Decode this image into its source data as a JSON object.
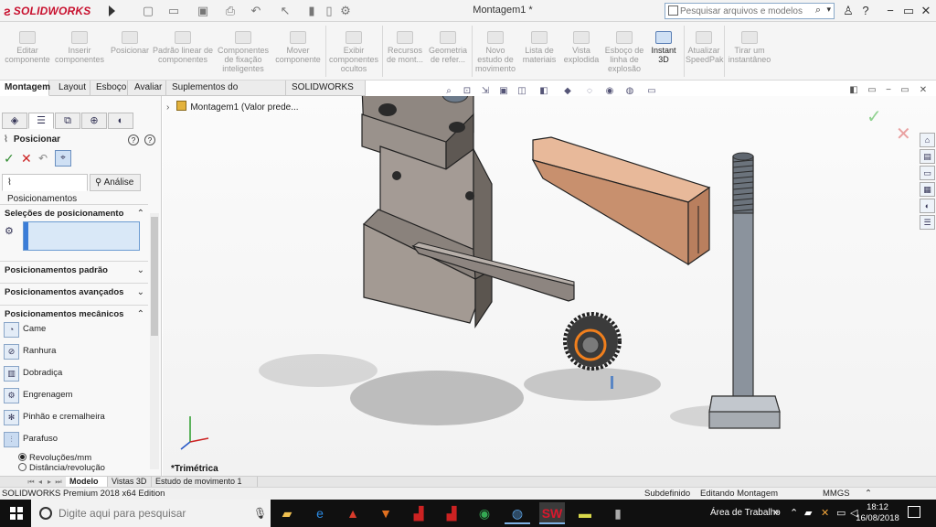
{
  "app": {
    "brand": "SOLIDWORKS",
    "document_title": "Montagem1 *",
    "search_placeholder": "Pesquisar arquivos e modelos"
  },
  "quick_access": [
    "new-icon",
    "open-icon",
    "save-icon",
    "print-icon",
    "undo-icon",
    "select-icon",
    "rebuild-icon",
    "options-icon"
  ],
  "window_controls": [
    "user-icon",
    "help-icon",
    "minimize-icon",
    "restore-icon",
    "close-icon"
  ],
  "ribbon": {
    "buttons": [
      {
        "label": "Editar componente"
      },
      {
        "label": "Inserir componentes"
      },
      {
        "label": "Posicionar"
      },
      {
        "label": "Padrão linear de componentes"
      },
      {
        "label": "Componentes de fixação inteligentes"
      },
      {
        "label": "Mover componente"
      },
      {
        "label": "Exibir componentes ocultos"
      },
      {
        "label": "Recursos de mont..."
      },
      {
        "label": "Geometria de refer..."
      },
      {
        "label": "Novo estudo de movimento"
      },
      {
        "label": "Lista de materiais"
      },
      {
        "label": "Vista explodida"
      },
      {
        "label": "Esboço de linha de explosão"
      },
      {
        "label": "Instant 3D"
      },
      {
        "label": "Atualizar SpeedPak"
      },
      {
        "label": "Tirar um instantâneo"
      }
    ]
  },
  "tabs": [
    "Montagem",
    "Layout",
    "Esboço",
    "Avaliar",
    "Suplementos do SOLIDWORKS",
    "SOLIDWORKS MBD"
  ],
  "left_panel": {
    "title": "Posicionar",
    "subtabs": [
      "Posicionamentos",
      "Análise"
    ],
    "sections": {
      "selections": "Seleções de posicionamento",
      "standard": "Posicionamentos padrão",
      "advanced": "Posicionamentos avançados",
      "mechanical": "Posicionamentos mecânicos"
    },
    "mechanical_items": [
      {
        "label": "Came",
        "icon": "cam-icon"
      },
      {
        "label": "Ranhura",
        "icon": "slot-icon"
      },
      {
        "label": "Dobradiça",
        "icon": "hinge-icon"
      },
      {
        "label": "Engrenagem",
        "icon": "gear-mate-icon"
      },
      {
        "label": "Pinhão e cremalheira",
        "icon": "rack-pinion-icon"
      },
      {
        "label": "Parafuso",
        "icon": "screw-icon"
      }
    ],
    "radio_options": [
      {
        "label": "Revoluções/mm",
        "selected": true
      },
      {
        "label": "Distância/revolução",
        "selected": false
      }
    ]
  },
  "viewport": {
    "tree_node": "Montagem1 (Valor prede...",
    "view_label": "*Trimétrica"
  },
  "bottom_tabs": [
    "Modelo",
    "Vistas 3D",
    "Estudo de movimento 1"
  ],
  "status": {
    "edition": "SOLIDWORKS Premium 2018 x64 Edition",
    "state": "Subdefinido",
    "mode": "Editando Montagem",
    "units": "MMGS"
  },
  "taskbar": {
    "search_placeholder": "Digite aqui para pesquisar",
    "desktop_label": "Área de Trabalho",
    "time": "18:12",
    "date": "16/08/2018"
  }
}
